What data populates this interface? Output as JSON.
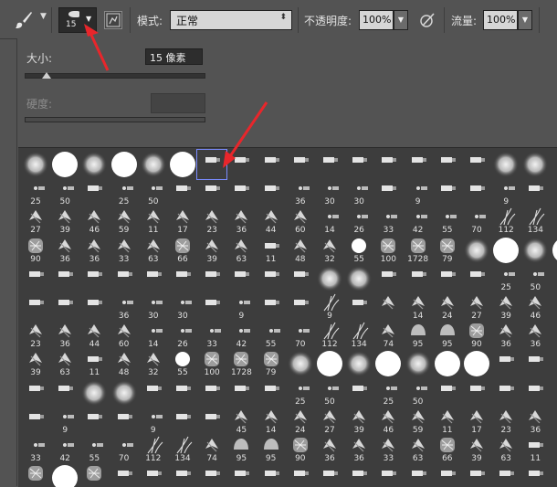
{
  "options_bar": {
    "brush_preset_size": "15",
    "mode_label": "模式:",
    "mode_value": "正常",
    "opacity_label": "不透明度:",
    "opacity_value": "100%",
    "flow_label": "流量:",
    "flow_value": "100%",
    "icons": [
      "brush-icon",
      "chevron-down-icon",
      "brush-panel-toggle-icon",
      "pressure-opacity-icon"
    ]
  },
  "brush_panel": {
    "size_label": "大小:",
    "size_value": "15 像素",
    "size_slider": 0.12,
    "hardness_label": "硬度:",
    "hardness_value": ""
  },
  "brush_grid": {
    "selected_index": 6,
    "rows": [
      [
        "",
        "",
        "",
        "",
        "",
        "",
        "",
        "",
        "",
        "",
        "",
        "",
        "",
        "",
        "",
        "",
        "",
        "",
        ""
      ],
      [
        "25",
        "50",
        "",
        "25",
        "50",
        "",
        "",
        "",
        "",
        "36",
        "30",
        "30",
        "",
        "9",
        "",
        "",
        "9",
        "",
        ""
      ],
      [
        "27",
        "39",
        "46",
        "59",
        "11",
        "17",
        "23",
        "36",
        "44",
        "60",
        "14",
        "26",
        "33",
        "42",
        "55",
        "70",
        "112",
        "134",
        ""
      ],
      [
        "90",
        "36",
        "36",
        "33",
        "63",
        "66",
        "39",
        "63",
        "11",
        "48",
        "32",
        "55",
        "100",
        "1728",
        "79",
        "",
        "",
        "",
        ""
      ],
      [
        "",
        "",
        "",
        "",
        "",
        "",
        "",
        "",
        "",
        "",
        "",
        "",
        "",
        "",
        "",
        "",
        "25",
        "50",
        ""
      ],
      [
        "",
        "",
        "",
        "36",
        "30",
        "30",
        "",
        "9",
        "",
        "",
        "9",
        "",
        "",
        "14",
        "24",
        "27",
        "39",
        "46",
        ""
      ],
      [
        "23",
        "36",
        "44",
        "60",
        "14",
        "26",
        "33",
        "42",
        "55",
        "70",
        "112",
        "134",
        "74",
        "95",
        "95",
        "90",
        "36",
        "36",
        ""
      ],
      [
        "39",
        "63",
        "11",
        "48",
        "32",
        "55",
        "100",
        "1728",
        "79",
        "",
        "",
        "",
        "",
        "",
        "",
        "",
        "",
        "",
        ""
      ],
      [
        "",
        "",
        "",
        "",
        "",
        "",
        "",
        "",
        "",
        "25",
        "50",
        "",
        "25",
        "50",
        "",
        "",
        "",
        "",
        ""
      ],
      [
        "",
        "9",
        "",
        "",
        "9",
        "",
        "",
        "45",
        "14",
        "24",
        "27",
        "39",
        "46",
        "59",
        "11",
        "17",
        "23",
        "36",
        "44"
      ],
      [
        "33",
        "42",
        "55",
        "70",
        "112",
        "134",
        "74",
        "95",
        "95",
        "90",
        "36",
        "36",
        "33",
        "63",
        "66",
        "39",
        "63",
        "11",
        "48"
      ],
      [
        "",
        "",
        "",
        "",
        "",
        "",
        "",
        "",
        "",
        "",
        "",
        "",
        "",
        "",
        "",
        "",
        "",
        "",
        ""
      ]
    ],
    "kinds": [
      [
        "soft",
        "hard",
        "soft",
        "hard",
        "soft",
        "hard",
        "stroke",
        "stroke",
        "stroke",
        "stroke",
        "stroke",
        "stroke",
        "stroke",
        "stroke",
        "stroke",
        "stroke",
        "soft",
        "soft",
        "stroke"
      ],
      [
        "dot",
        "dot",
        "stroke",
        "dot",
        "dot",
        "stroke",
        "stroke",
        "stroke",
        "stroke",
        "dot",
        "dot",
        "dot",
        "stroke",
        "dot",
        "stroke",
        "stroke",
        "dot",
        "stroke",
        "stroke"
      ],
      [
        "leaf",
        "leaf",
        "leaf",
        "leaf",
        "leaf",
        "leaf",
        "leaf",
        "leaf",
        "leaf",
        "leaf",
        "dot",
        "dot",
        "dot",
        "dot",
        "dot",
        "dot",
        "grass",
        "grass",
        "stroke"
      ],
      [
        "texture",
        "leaf",
        "leaf",
        "leaf",
        "leaf",
        "texture",
        "leaf",
        "leaf",
        "stroke",
        "leaf",
        "leaf",
        "hard",
        "texture",
        "texture",
        "texture",
        "soft",
        "hard",
        "soft",
        "hard"
      ],
      [
        "stroke",
        "stroke",
        "stroke",
        "stroke",
        "stroke",
        "stroke",
        "stroke",
        "stroke",
        "stroke",
        "stroke",
        "soft",
        "soft",
        "stroke",
        "stroke",
        "stroke",
        "stroke",
        "dot",
        "dot",
        "stroke"
      ],
      [
        "stroke",
        "stroke",
        "stroke",
        "dot",
        "dot",
        "dot",
        "stroke",
        "dot",
        "stroke",
        "stroke",
        "grass",
        "stroke",
        "leaf",
        "leaf",
        "leaf",
        "leaf",
        "leaf",
        "leaf",
        "leaf"
      ],
      [
        "leaf",
        "leaf",
        "leaf",
        "leaf",
        "dot",
        "dot",
        "dot",
        "dot",
        "dot",
        "dot",
        "grass",
        "grass",
        "leaf",
        "blob",
        "blob",
        "texture",
        "leaf",
        "leaf",
        "leaf"
      ],
      [
        "leaf",
        "leaf",
        "stroke",
        "leaf",
        "leaf",
        "hard",
        "texture",
        "texture",
        "texture",
        "soft",
        "hard",
        "soft",
        "hard",
        "soft",
        "hard",
        "hard",
        "stroke",
        "stroke",
        "stroke"
      ],
      [
        "stroke",
        "stroke",
        "soft",
        "soft",
        "stroke",
        "stroke",
        "stroke",
        "stroke",
        "stroke",
        "dot",
        "dot",
        "stroke",
        "dot",
        "dot",
        "stroke",
        "stroke",
        "stroke",
        "stroke",
        "stroke"
      ],
      [
        "stroke",
        "dot",
        "stroke",
        "stroke",
        "dot",
        "stroke",
        "stroke",
        "leaf",
        "leaf",
        "leaf",
        "leaf",
        "leaf",
        "leaf",
        "leaf",
        "leaf",
        "leaf",
        "leaf",
        "leaf",
        "leaf"
      ],
      [
        "dot",
        "dot",
        "dot",
        "dot",
        "grass",
        "grass",
        "leaf",
        "blob",
        "blob",
        "texture",
        "leaf",
        "leaf",
        "leaf",
        "leaf",
        "texture",
        "leaf",
        "leaf",
        "stroke",
        "leaf"
      ],
      [
        "texture",
        "hard",
        "texture",
        "stroke",
        "stroke",
        "stroke",
        "stroke",
        "stroke",
        "stroke",
        "stroke",
        "stroke",
        "stroke",
        "stroke",
        "stroke",
        "stroke",
        "stroke",
        "stroke",
        "stroke",
        "stroke"
      ]
    ]
  }
}
